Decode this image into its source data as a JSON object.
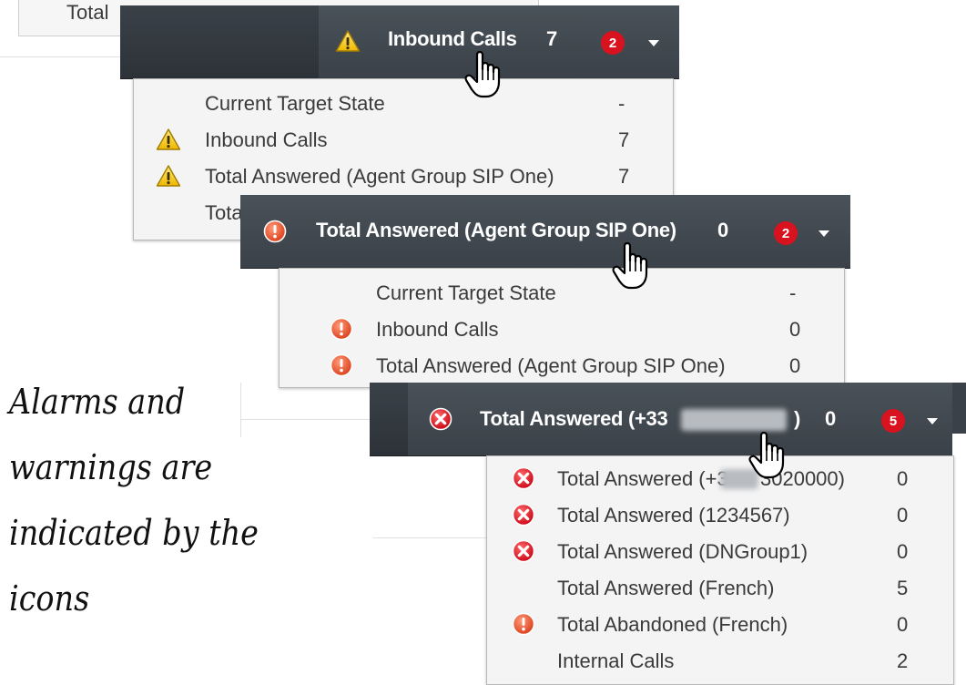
{
  "top_card": {
    "label": "Total"
  },
  "panels": [
    {
      "title": "Inbound Calls",
      "value": "7",
      "badge": "2",
      "status_icon": "warning-triangle-icon",
      "rows": [
        {
          "icon": "",
          "label": "Current Target State",
          "value": "-"
        },
        {
          "icon": "warning-triangle-icon",
          "label": "Inbound Calls",
          "value": "7"
        },
        {
          "icon": "warning-triangle-icon",
          "label": "Total Answered (Agent Group SIP One)",
          "value": "7"
        },
        {
          "icon": "",
          "label": "Tota",
          "value": ""
        }
      ]
    },
    {
      "title": "Total Answered (Agent Group SIP One)",
      "value": "0",
      "badge": "2",
      "status_icon": "alert-exclamation-icon",
      "rows": [
        {
          "icon": "",
          "label": "Current Target State",
          "value": "-"
        },
        {
          "icon": "alert-exclamation-icon",
          "label": "Inbound Calls",
          "value": "0"
        },
        {
          "icon": "alert-exclamation-icon",
          "label": "Total Answered (Agent Group SIP One)",
          "value": "0"
        }
      ]
    },
    {
      "title_start": "Total Answered (+33",
      "title_end": ")",
      "value": "0",
      "badge": "5",
      "status_icon": "error-x-icon",
      "rows": [
        {
          "icon": "error-x-icon",
          "label_start": "Total Answered (+3",
          "label_end": "3020000)",
          "value": "0"
        },
        {
          "icon": "error-x-icon",
          "label": "Total Answered (1234567)",
          "value": "0"
        },
        {
          "icon": "error-x-icon",
          "label": "Total Answered (DNGroup1)",
          "value": "0"
        },
        {
          "icon": "",
          "label": "Total Answered (French)",
          "value": "5"
        },
        {
          "icon": "alert-exclamation-icon",
          "label": "Total Abandoned (French)",
          "value": "0"
        },
        {
          "icon": "",
          "label": "Internal Calls",
          "value": "2"
        }
      ]
    }
  ],
  "caption": [
    "Alarms and",
    "warnings are",
    "indicated by the",
    "icons"
  ],
  "colors": {
    "bar": "#3a4148",
    "badge": "#d8121e",
    "warning": "#f2c200",
    "alert": "#e2502a",
    "error": "#d8121e"
  }
}
